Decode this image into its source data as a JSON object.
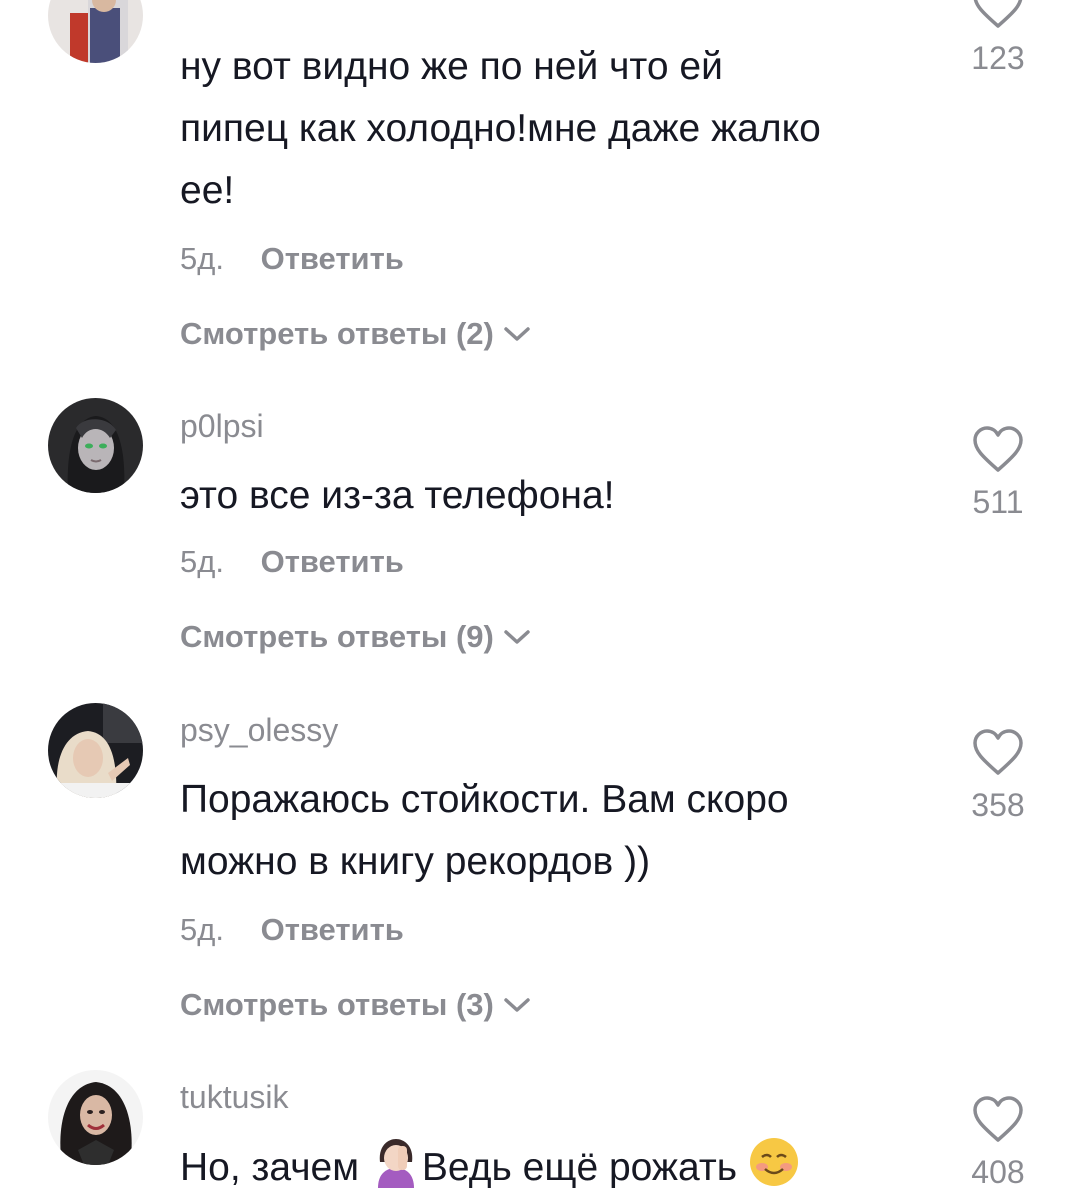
{
  "comments": [
    {
      "username": "",
      "lines": [
        "ну вот видно же по ней что ей",
        "пипец как холодно!мне даже жалко",
        "ее!"
      ],
      "time": "5д.",
      "reply_label": "Ответить",
      "view_replies": "Смотреть ответы (2)",
      "likes": "123",
      "avatar_icon": "user-photo-avatar"
    },
    {
      "username": "p0lpsi",
      "lines": [
        "это все из-за телефона!"
      ],
      "time": "5д.",
      "reply_label": "Ответить",
      "view_replies": "Смотреть ответы (9)",
      "likes": "511",
      "avatar_icon": "illustrated-girl-avatar"
    },
    {
      "username": "psy_olessy",
      "lines": [
        "Поражаюсь стойкости. Вам скоро",
        "можно в книгу рекордов ))"
      ],
      "time": "5д.",
      "reply_label": "Ответить",
      "view_replies": "Смотреть ответы (3)",
      "likes": "358",
      "avatar_icon": "blonde-woman-avatar"
    },
    {
      "username": "tuktusik",
      "text_before_emoji": "Но, зачем ",
      "text_after_emoji": "Ведь ещё рожать ",
      "emoji_1": "facepalm-woman-emoji",
      "emoji_2": "smiling-blush-emoji",
      "likes": "408",
      "avatar_icon": "dark-haired-woman-avatar"
    }
  ],
  "colors": {
    "text": "#161823",
    "secondary": "#8a8b91",
    "background": "#ffffff"
  }
}
